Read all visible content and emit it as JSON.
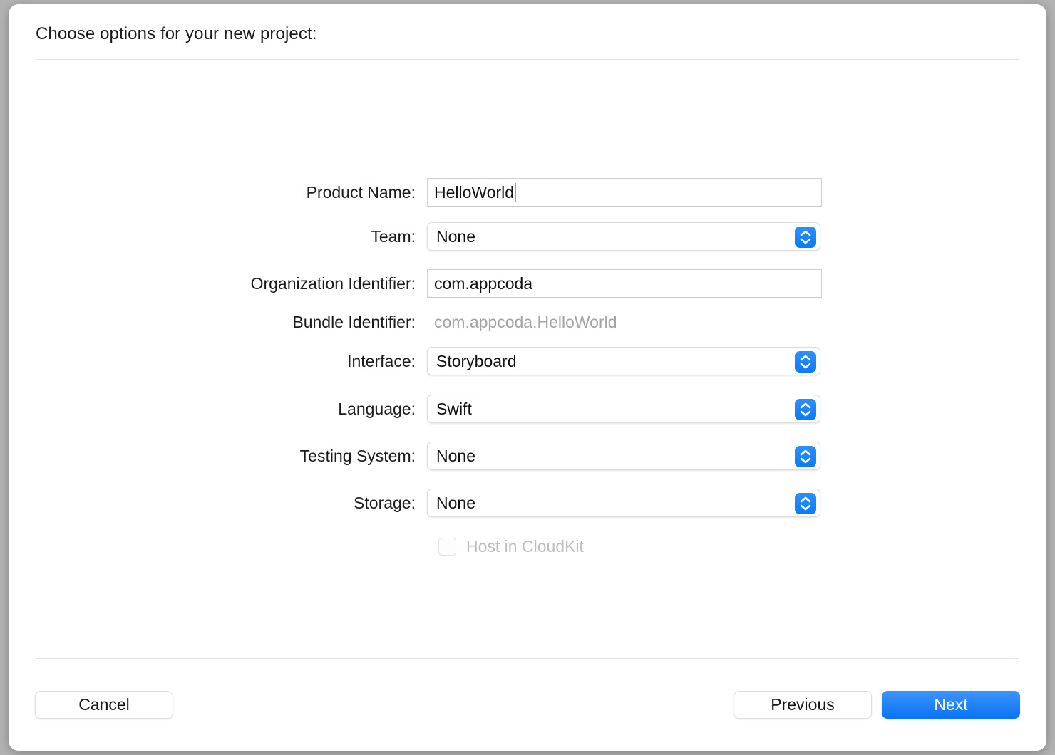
{
  "dialog": {
    "title": "Choose options for your new project:"
  },
  "form": {
    "rows": [
      {
        "label": "Product Name:",
        "type": "textfield",
        "value": "HelloWorld",
        "caret": true
      },
      {
        "label": "Team:",
        "type": "popup",
        "value": "None"
      },
      {
        "label": "Organization Identifier:",
        "type": "textfield",
        "value": "com.appcoda",
        "caret": false
      },
      {
        "label": "Bundle Identifier:",
        "type": "static",
        "value": "com.appcoda.HelloWorld"
      },
      {
        "label": "Interface:",
        "type": "popup",
        "value": "Storyboard"
      },
      {
        "label": "Language:",
        "type": "popup",
        "value": "Swift"
      },
      {
        "label": "Testing System:",
        "type": "popup",
        "value": "None"
      },
      {
        "label": "Storage:",
        "type": "popup",
        "value": "None"
      }
    ],
    "checkbox": {
      "label": "Host in CloudKit",
      "checked": false,
      "enabled": false
    }
  },
  "footer": {
    "cancel_label": "Cancel",
    "previous_label": "Previous",
    "next_label": "Next"
  },
  "colors": {
    "accent": "#0a7cf7",
    "primary_button": "#1a80fa",
    "caret": "#6eaaf5",
    "disabled_text": "#a3a3a3",
    "window_background": "#ffffff",
    "backdrop": "#b3b3b3"
  }
}
